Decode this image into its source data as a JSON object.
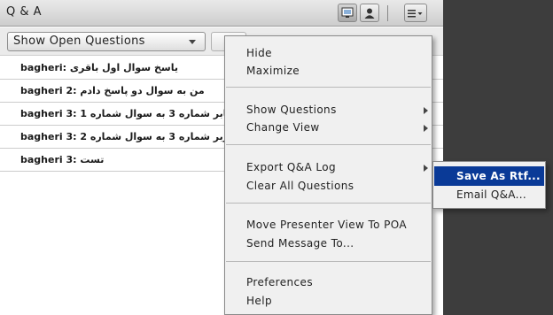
{
  "pod": {
    "title": "Q & A",
    "filter": {
      "selected": "Show Open Questions"
    }
  },
  "questions": [
    {
      "text": "bagheri: یاسخ سوال اول باقری"
    },
    {
      "text": "bagheri 2: من به سوال دو پاسخ دادم"
    },
    {
      "text": "bagheri 3: 1 پاسخ کابر شماره 3 به سوال شماره"
    },
    {
      "text": "bagheri 3: 2 پاسخ کاربر شماره 3 به سوال شماره"
    },
    {
      "text": "bagheri 3: تست"
    }
  ],
  "menu": {
    "hide": "Hide",
    "maximize": "Maximize",
    "show_questions": "Show Questions",
    "change_view": "Change View",
    "export_log": "Export Q&A Log",
    "clear_all": "Clear All Questions",
    "move_presenter": "Move Presenter View To POA",
    "send_message": "Send Message To...",
    "preferences": "Preferences",
    "help": "Help"
  },
  "submenu": {
    "save_rtf": "Save As Rtf...",
    "email": "Email Q&A..."
  },
  "colors": {
    "highlight": "#0a3a97",
    "background": "#3d3d3d"
  }
}
